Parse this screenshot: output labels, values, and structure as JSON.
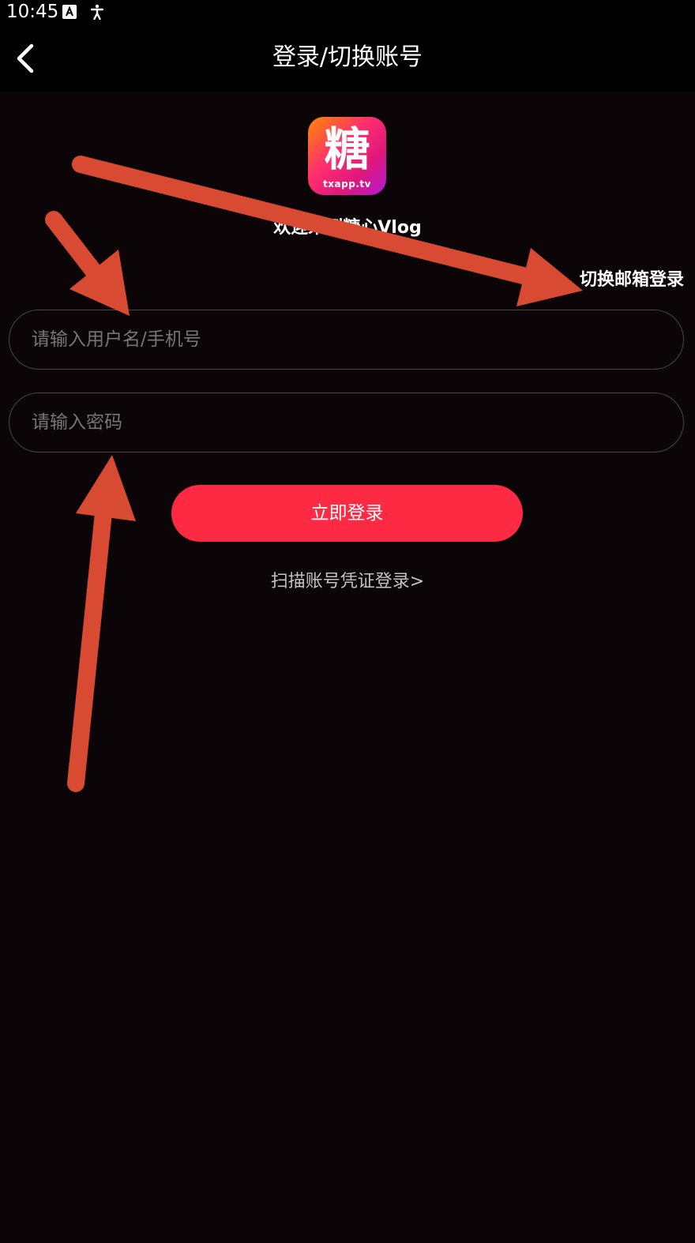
{
  "status_bar": {
    "time": "10:45",
    "icons": [
      "a-icon",
      "accessibility-icon"
    ]
  },
  "header": {
    "title": "登录/切换账号",
    "back_icon": "chevron-left-icon"
  },
  "logo": {
    "glyph": "糖",
    "subtext": "txapp.tv"
  },
  "welcome": {
    "text": "欢迎来到糖心Vlog"
  },
  "switch_email": {
    "label": "切换邮箱登录"
  },
  "form": {
    "username_placeholder": "请输入用户名/手机号",
    "username_value": "",
    "password_placeholder": "请输入密码",
    "password_value": "",
    "submit_label": "立即登录"
  },
  "scan_login": {
    "label": "扫描账号凭证登录>"
  },
  "colors": {
    "background": "#0c0508",
    "header_bg": "#000000",
    "primary_button": "#fe2a43",
    "field_border": "#4a4446",
    "placeholder": "#7a7476",
    "annotation_arrow": "#d84a32"
  }
}
